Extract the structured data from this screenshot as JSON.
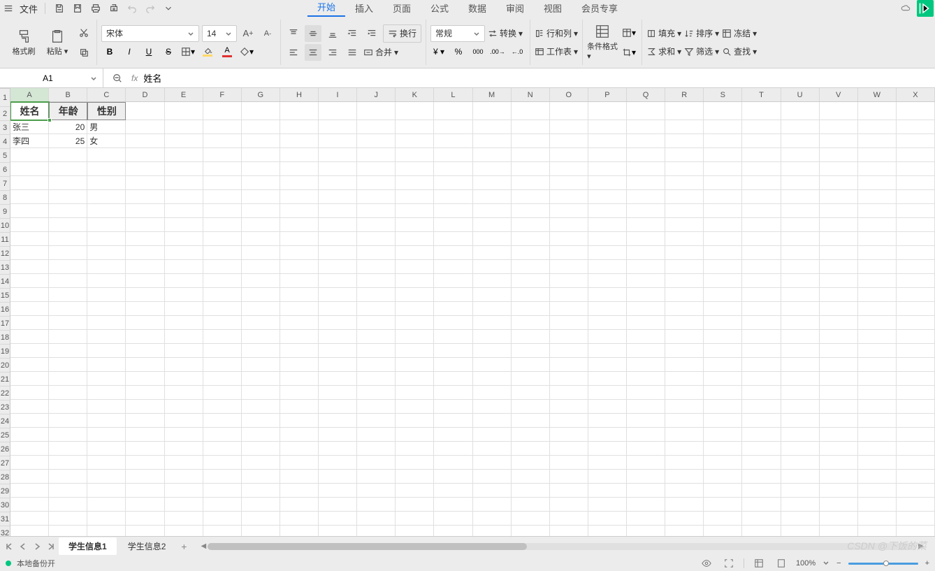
{
  "menubar": {
    "file": "文件"
  },
  "tabs": {
    "home": "开始",
    "insert": "插入",
    "page": "页面",
    "formula": "公式",
    "data": "数据",
    "review": "审阅",
    "view": "视图",
    "member": "会员专享"
  },
  "ribbon": {
    "format_painter": "格式刷",
    "paste": "粘贴",
    "font_name": "宋体",
    "font_size": "14",
    "number_format": "常规",
    "wrap": "换行",
    "merge": "合并",
    "convert": "转换",
    "row_col": "行和列",
    "worksheet": "工作表",
    "cond_fmt": "条件格式",
    "fill": "填充",
    "sort": "排序",
    "freeze": "冻结",
    "sum": "求和",
    "filter": "筛选",
    "find": "查找"
  },
  "namebox": {
    "cell": "A1",
    "formula": "姓名"
  },
  "columns": [
    "A",
    "B",
    "C",
    "D",
    "E",
    "F",
    "G",
    "H",
    "I",
    "J",
    "K",
    "L",
    "M",
    "N",
    "O",
    "P",
    "Q",
    "R",
    "S",
    "T",
    "U",
    "V",
    "W",
    "X"
  ],
  "rows": [
    "1",
    "2",
    "3",
    "4",
    "5",
    "6",
    "7",
    "8",
    "9",
    "10",
    "11",
    "12",
    "13",
    "14",
    "15",
    "16",
    "17",
    "18",
    "19",
    "20",
    "21",
    "22",
    "23",
    "24",
    "25",
    "26",
    "27",
    "28",
    "29",
    "30",
    "31",
    "32"
  ],
  "cells": {
    "header": {
      "a": "姓名",
      "b": "年龄",
      "c": "性别"
    },
    "r2": {
      "a": "张三",
      "b": "20",
      "c": "男"
    },
    "r3": {
      "a": "李四",
      "b": "25",
      "c": "女"
    }
  },
  "sheets": {
    "s1": "学生信息1",
    "s2": "学生信息2"
  },
  "status": {
    "backup": "本地备份开",
    "zoom": "100%"
  },
  "watermark": "CSDN @下饭的菜"
}
